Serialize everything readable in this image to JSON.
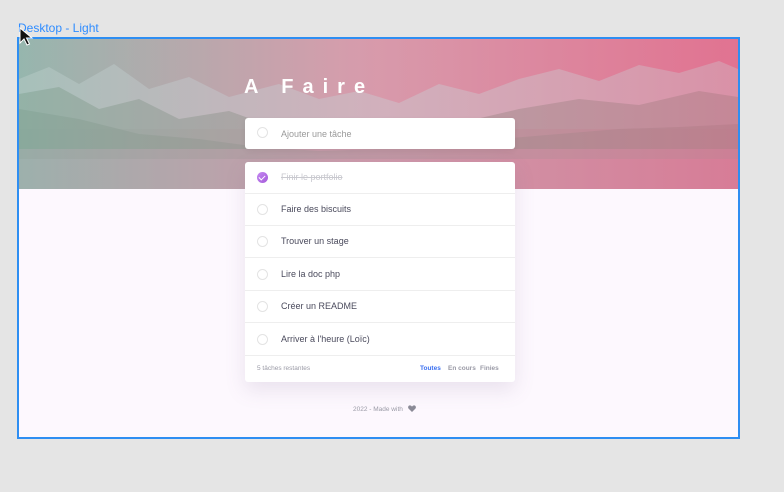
{
  "canvas": {
    "frame_label": "Desktop - Light"
  },
  "app": {
    "title": "A Faire",
    "new_task": {
      "placeholder": "Ajouter une tâche"
    },
    "tasks": [
      {
        "label": "Finir le portfolio",
        "done": true
      },
      {
        "label": "Faire des biscuits",
        "done": false
      },
      {
        "label": "Trouver un stage",
        "done": false
      },
      {
        "label": "Lire la doc php",
        "done": false
      },
      {
        "label": "Créer un README",
        "done": false
      },
      {
        "label": "Arriver à l'heure (Loïc)",
        "done": false
      }
    ],
    "footer": {
      "remaining": "5 tâches restantes",
      "filters": [
        {
          "label": "Toutes",
          "active": true
        },
        {
          "label": "En cours",
          "active": false
        },
        {
          "label": "Finies",
          "active": false
        }
      ]
    },
    "credit": "2022 - Made with"
  },
  "colors": {
    "accent": "#3a6ff0",
    "check_gradient_start": "#c488f2",
    "check_gradient_end": "#a55bd9",
    "frame_outline": "#2e8ef2",
    "page_background": "#fdf8fe"
  },
  "icons": {
    "cursor": "arrow-cursor-icon",
    "check": "check-icon",
    "heart": "heart-icon"
  }
}
